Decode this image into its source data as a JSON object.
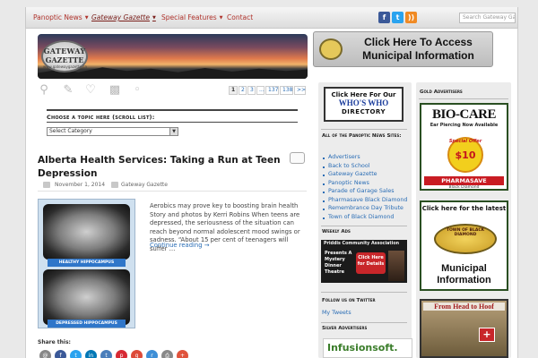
{
  "nav": {
    "items": [
      {
        "label": "Panoptic News",
        "has_menu": true
      },
      {
        "label": "Gateway Gazette",
        "has_menu": true
      },
      {
        "label": "Special Features",
        "has_menu": true
      },
      {
        "label": "Contact",
        "has_menu": false
      }
    ],
    "search_placeholder": "Search Gateway Gazette"
  },
  "header": {
    "logo_line1": "GATEWAY",
    "logo_line2": "GAZETTE",
    "logo_line3": "www.gatewaygazette.ca",
    "municipal_banner_line1": "Click Here To Access",
    "municipal_banner_line2": "Municipal Information"
  },
  "pagination": {
    "pages": [
      "1",
      "2",
      "3",
      "...",
      "137",
      "138",
      ">>"
    ],
    "current": "1"
  },
  "topics": {
    "label": "Choose a topic here (scroll list):",
    "selected": "Select Category"
  },
  "post": {
    "title": "Alberta Health Services: Taking a Run at Teen Depression",
    "date": "November 1, 2014",
    "author": "Gateway Gazette",
    "excerpt": "Aerobics may prove key to boosting brain health Story and photos by Kerri Robins When teens are depressed, the seriousness of the situation can reach beyond normal adolescent mood swings or sadness. “About 15 per cent of teenagers will suffer …",
    "read_more": "Continue reading →",
    "image_label_top": "HEALTHY HIPPOCAMPUS",
    "image_label_bottom": "DEPRESSED HIPPOCAMPUS"
  },
  "share": {
    "label": "Share this:"
  },
  "whoswho": {
    "line1": "Click Here For Our",
    "line2": "WHO'S WHO",
    "line3": "DIRECTORY"
  },
  "sites": {
    "heading": "All of the Panoptic News Sites:",
    "links": [
      "Advertisers",
      "Back to School",
      "Gateway Gazette",
      "Panoptic News",
      "Parade of Garage Sales",
      "Pharmasave Black Diamond",
      "Remembrance Day Tribute",
      "Town of Black Diamond"
    ]
  },
  "weekly_ads": {
    "heading": "Weekly Ads",
    "title": "Priddis Community Association",
    "presents": "Presents A Mystery Dinner Theatre",
    "button": "Click Here for Details"
  },
  "twitter": {
    "heading": "Follow us on Twitter",
    "link": "My Tweets"
  },
  "silver": {
    "heading": "Silver Advertisers",
    "brand": "Infusionsoft."
  },
  "gold": {
    "heading": "Gold Advertisers"
  },
  "biocare": {
    "brand": "BIO-CARE",
    "line1": "Ear Piercing Now Available",
    "offer": "Special Offer",
    "price": "$10",
    "pharmacy": "PHARMASAVE",
    "location": "Black Diamond"
  },
  "blackdiamond_ad": {
    "heading": "Click here for the latest",
    "seal_text": "TOWN OF BLACK DIAMOND",
    "line1": "Municipal",
    "line2": "Information"
  },
  "hoof_ad": {
    "title": "From Head to Hoof"
  },
  "colors": {
    "nav_text": "#b0332c",
    "link": "#2a6db5",
    "accent_green": "#2a4f22"
  }
}
